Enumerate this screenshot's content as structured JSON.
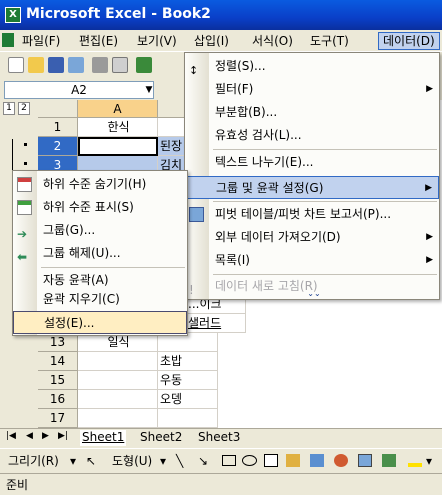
{
  "window": {
    "title": "Microsoft Excel - Book2",
    "app_icon": "X"
  },
  "menubar": {
    "items": [
      "파일(F)",
      "편집(E)",
      "보기(V)",
      "삽입(I)",
      "서식(O)",
      "도구(T)",
      "데이터(D)"
    ]
  },
  "namebox": {
    "value": "A2"
  },
  "grid": {
    "outline_levels": [
      "1",
      "2"
    ],
    "columns": [
      "A",
      "B"
    ],
    "rows": [
      {
        "num": "1",
        "a": "한식",
        "b": ""
      },
      {
        "num": "2",
        "a": "",
        "b": "된장"
      },
      {
        "num": "3",
        "a": "",
        "b": "김치"
      },
      {
        "num": "11",
        "a": "",
        "b": "...이크"
      },
      {
        "num": "12",
        "a": "",
        "b": "샐러드"
      },
      {
        "num": "13",
        "a": "일식",
        "b": ""
      },
      {
        "num": "14",
        "a": "",
        "b": "초밥"
      },
      {
        "num": "15",
        "a": "",
        "b": "우동"
      },
      {
        "num": "16",
        "a": "",
        "b": "오뎅"
      },
      {
        "num": "17",
        "a": "",
        "b": ""
      }
    ]
  },
  "data_menu": {
    "items": [
      {
        "label": "정렬(S)..."
      },
      {
        "label": "필터(F)"
      },
      {
        "label": "부분합(B)..."
      },
      {
        "label": "유효성 검사(L)..."
      },
      {
        "label": "텍스트 나누기(E)..."
      },
      {
        "label": "그룹 및 윤곽 설정(G)"
      },
      {
        "label": "피벗 테이블/피벗 차트 보고서(P)..."
      },
      {
        "label": "외부 데이터 가져오기(D)"
      },
      {
        "label": "목록(I)"
      },
      {
        "label": "데이터 새로 고침(R)"
      }
    ]
  },
  "group_submenu": {
    "items": [
      {
        "label": "하위 수준 숨기기(H)"
      },
      {
        "label": "하위 수준 표시(S)"
      },
      {
        "label": "그룹(G)..."
      },
      {
        "label": "그룹 해제(U)..."
      },
      {
        "label": "자동 윤곽(A)"
      },
      {
        "label": "윤곽 지우기(C)"
      },
      {
        "label": "설정(E)..."
      }
    ]
  },
  "sheets": [
    "Sheet1",
    "Sheet2",
    "Sheet3"
  ],
  "drawbar": {
    "draw_label": "그리기(R)",
    "shapes_label": "도형(U)"
  },
  "status": {
    "text": "준비"
  },
  "colors": {
    "title_blue": "#0A3FC8",
    "highlight": "#FFEEC2",
    "selection": "#316AC5"
  }
}
